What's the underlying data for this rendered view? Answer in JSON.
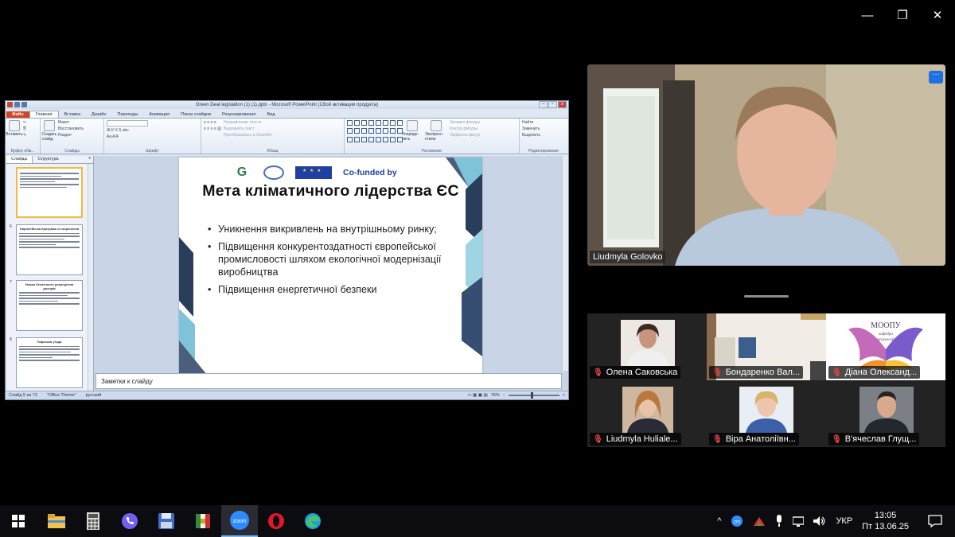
{
  "zoom_window": {
    "controls": [
      "—",
      "❐",
      "✕"
    ]
  },
  "powerpoint": {
    "title": "Green Deal legislation (1) (1).pptx - Microsoft PowerPoint (Сбой активации продукта)",
    "tabs": [
      "Файл",
      "Главная",
      "Вставка",
      "Дизайн",
      "Переходы",
      "Анимация",
      "Показ слайдов",
      "Рецензирование",
      "Вид"
    ],
    "ribbon": {
      "paste": "Вставить",
      "create_slide": "Создать слайд",
      "layout": "Макет",
      "restore": "Восстановить",
      "section": "Раздел",
      "text_direction": "Направление текста",
      "align_text": "Выровнять текст",
      "convert_smartart": "Преобразовать в SmartArt",
      "arrange": "Упорядо-чить",
      "quick_styles": "Экспресс-стили",
      "shape_fill": "Заливка фигуры",
      "shape_outline": "Контур фигуры",
      "shape_effects": "Эффекты фигур",
      "find": "Найти",
      "replace": "Заменить",
      "select": "Выделить",
      "groups": [
        "Буфер обм...",
        "Слайды",
        "Шрифт",
        "Абзац",
        "Рисование",
        "Редактирование"
      ]
    },
    "pane_tabs": [
      "Слайды",
      "Структура"
    ],
    "thumbnails": [
      {
        "num": "",
        "title": ""
      },
      {
        "num": "6",
        "title": "Європейська програма зі скорочення"
      },
      {
        "num": "7",
        "title": "Умови безпечного розміщення доходів"
      },
      {
        "num": "8",
        "title": "Паризька угода"
      }
    ],
    "slide": {
      "cofunded": "Co-funded by",
      "heading": "Мета кліматичного лідерства ЄС",
      "bullets": [
        "Уникнення викривлень на внутрішньому ринку;",
        "Підвищення конкурентоздатності європейської промисловості шляхом екологічної модернізації виробництва",
        "Підвищення енергетичної безпеки"
      ]
    },
    "notes_placeholder": "Заметки к слайду",
    "status": {
      "slide": "Слайд 5 из 72",
      "theme": "\"Office Theme\"",
      "lang": "русский",
      "zoom": "76%"
    }
  },
  "speaker": {
    "name": "Liudmyla Golovko",
    "more": "···"
  },
  "participants": [
    {
      "name": "Олена Саковська",
      "muted": true
    },
    {
      "name": "Бондаренко Вал...",
      "muted": true
    },
    {
      "name": "Діана Олександ...",
      "muted": true
    },
    {
      "name": "Liudmyla Huliale...",
      "muted": true
    },
    {
      "name": "Віра Анатоліївн...",
      "muted": true
    },
    {
      "name": "В'ячеслав Глущ...",
      "muted": true
    }
  ],
  "moopu_logo": {
    "line1": "МООПУ",
    "line2": "кафедра",
    "line3": "психології"
  },
  "mic_icon": "mic-muted-icon",
  "taskbar": {
    "apps": [
      "windows-start",
      "file-explorer",
      "calculator",
      "viber",
      "save-floppy",
      "winrar",
      "zoom",
      "opera",
      "edge"
    ],
    "tray": {
      "chevron": "^",
      "lang": "УКР",
      "time": "13:05",
      "date": "Пт 13.06.25"
    }
  }
}
